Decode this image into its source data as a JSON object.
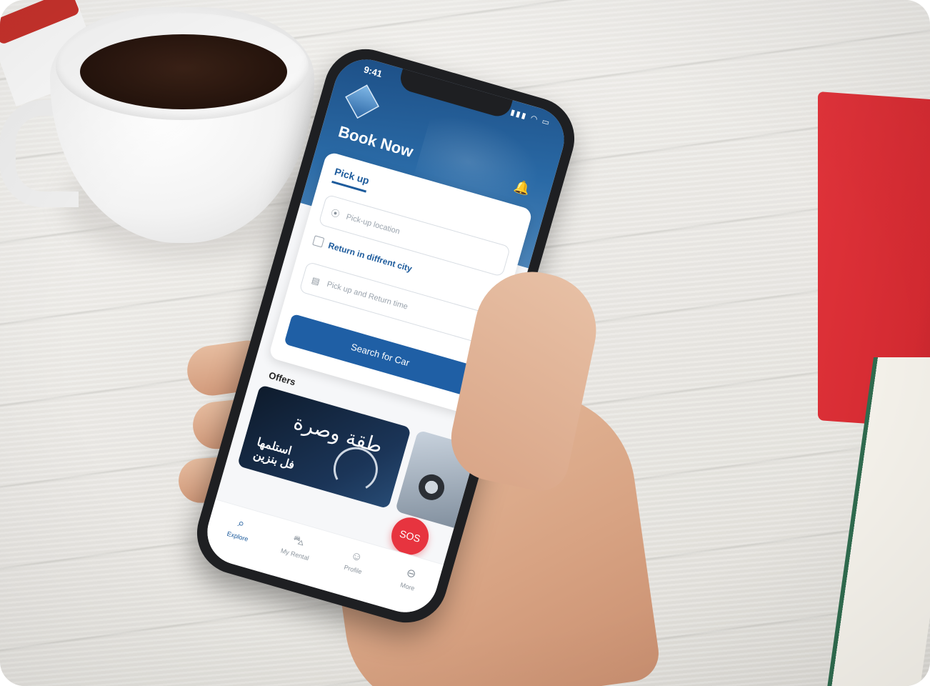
{
  "phone": {
    "status": {
      "time": "9:41"
    },
    "header": {
      "title": "Book Now"
    },
    "booking_card": {
      "tab_label": "Pick up",
      "pickup_placeholder": "Pick-up location",
      "return_checkbox_label": "Return in diffrent city",
      "time_placeholder": "Pick up and Return time",
      "search_button_label": "Search for Car"
    },
    "offers": {
      "section_title": "Offers",
      "offer1_line1": "طقة وصرة",
      "offer1_line2": "استلمها",
      "offer1_line3": "فل بنزين"
    },
    "sos_label": "SOS",
    "nav": {
      "items": [
        {
          "label": "Explore",
          "icon": "search-icon"
        },
        {
          "label": "My Rental",
          "icon": "car-icon"
        },
        {
          "label": "Profile",
          "icon": "profile-icon"
        },
        {
          "label": "More",
          "icon": "more-icon"
        }
      ]
    }
  },
  "colors": {
    "primary": "#1f5fa5",
    "sos": "#e7343f",
    "notebook": "#d42a31"
  }
}
